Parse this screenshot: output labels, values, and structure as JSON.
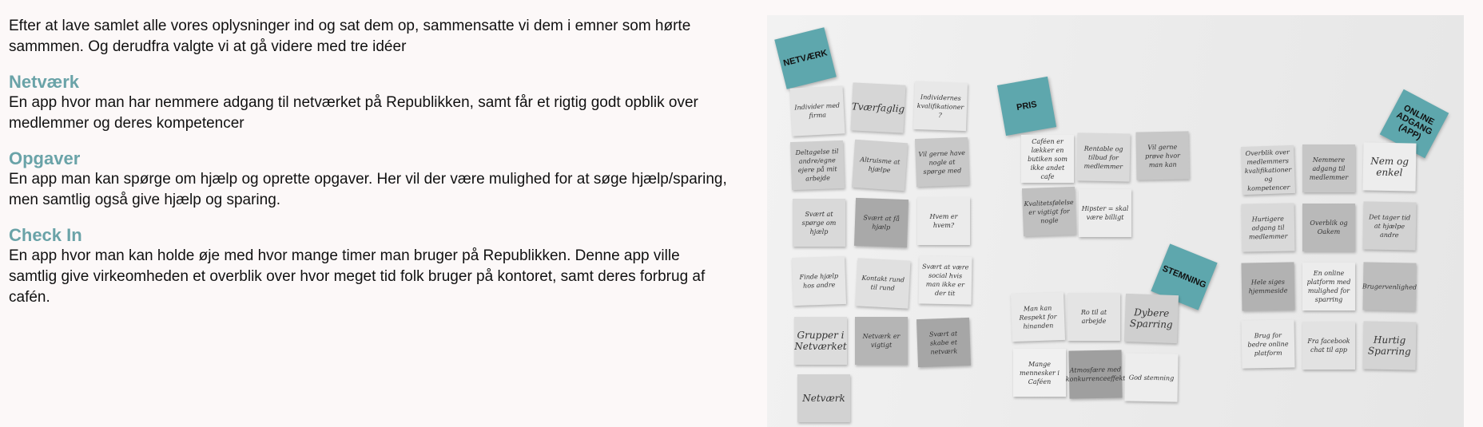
{
  "intro": "Efter at lave samlet alle vores oplysninger ind og sat dem op, sammensatte vi dem i emner som hørte sammmen. Og derudfra valgte vi at gå videre med tre idéer",
  "sections": [
    {
      "heading": "Netværk",
      "body": "En app hvor man har nemmere adgang til netværket på Republikken, samt får et rigtig godt opblik over medlemmer og deres kompetencer"
    },
    {
      "heading": "Opgaver",
      "body": "En app man kan spørge om hjælp og oprette opgaver. Her vil der være mulighed for at søge hjælp/sparing, men samtlig også give hjælp og sparing."
    },
    {
      "heading": "Check In",
      "body": "En app hvor man kan holde øje med hvor mange timer man bruger på Republikken. Denne app ville samtlig give virkeomheden et overblik over hvor meget tid folk bruger på kontoret, samt deres forbrug af cafén."
    }
  ],
  "photo": {
    "accent": "#5ea7ad",
    "tags": [
      "NETVÆRK",
      "PRIS",
      "STEMNING",
      "ONLINE ADGANG (APP)"
    ],
    "notes": [
      {
        "text": "Individer med firma",
        "shade": "#e4e4e4"
      },
      {
        "text": "Tværfaglig",
        "shade": "#d6d6d6"
      },
      {
        "text": "Individernes kvalifikationer ?",
        "shade": "#e8e8e8"
      },
      {
        "text": "Deltagelse til andre/egne ejere på mit arbejde",
        "shade": "#cfcfcf"
      },
      {
        "text": "Altruisme at hjælpe",
        "shade": "#d0d0d0"
      },
      {
        "text": "Vil gerne have nogle at spørge med",
        "shade": "#c8c8c8"
      },
      {
        "text": "Svært at spørge om hjælp",
        "shade": "#d9d9d9"
      },
      {
        "text": "Svært at få hjælp",
        "shade": "#a9a9a9"
      },
      {
        "text": "Hvem er hvem?",
        "shade": "#ebebeb"
      },
      {
        "text": "Finde hjælp hos andre",
        "shade": "#e6e6e6"
      },
      {
        "text": "Kontakt rund til rund",
        "shade": "#e0e0e0"
      },
      {
        "text": "Svært at være social hvis man ikke er der tit",
        "shade": "#ececec"
      },
      {
        "text": "Grupper i Netværket",
        "shade": "#dcdcdc"
      },
      {
        "text": "Netværk er vigtigt",
        "shade": "#b5b5b5"
      },
      {
        "text": "Svært at skabe et netværk",
        "shade": "#a6a6a6"
      },
      {
        "text": "Netværk",
        "shade": "#d2d2d2"
      },
      {
        "text": "Caféen er lækker en butiken som ikke andet cafe",
        "shade": "#eeeeee"
      },
      {
        "text": "Rentable og tilbud for medlemmer",
        "shade": "#dadada"
      },
      {
        "text": "Vil gerne prøve hvor man kan",
        "shade": "#c7c7c7"
      },
      {
        "text": "Kvalitetsfølelse er vigtigt for nogle",
        "shade": "#c0c0c0"
      },
      {
        "text": "Hipster = skal være billigt",
        "shade": "#ececec"
      },
      {
        "text": "Man kan Respekt for hinanden",
        "shade": "#e9e9e9"
      },
      {
        "text": "Ro til at arbejde",
        "shade": "#e4e4e4"
      },
      {
        "text": "Dybere Sparring",
        "shade": "#cfcfcf"
      },
      {
        "text": "Mange mennesker i Caféen",
        "shade": "#f0f0f0"
      },
      {
        "text": "Atmosfære med konkurrenceeffekt",
        "shade": "#9f9f9f"
      },
      {
        "text": "God stemning",
        "shade": "#ededed"
      },
      {
        "text": "Overblik over medlemmers kvalifikationer og kompetencer",
        "shade": "#d8d8d8"
      },
      {
        "text": "Nemmere adgang til medlemmer",
        "shade": "#c6c6c6"
      },
      {
        "text": "Nem og enkel",
        "shade": "#ededed"
      },
      {
        "text": "Hurtigere adgang til medlemmer",
        "shade": "#d9d9d9"
      },
      {
        "text": "Overblik og Oakem",
        "shade": "#b9b9b9"
      },
      {
        "text": "Det tager tid at hjælpe andre",
        "shade": "#d2d2d2"
      },
      {
        "text": "Hele siges hjemmeside",
        "shade": "#b2b2b2"
      },
      {
        "text": "En online platform med mulighed for sparring",
        "shade": "#ececec"
      },
      {
        "text": "Brugervenlighed",
        "shade": "#bdbdbd"
      },
      {
        "text": "Brug for bedre online platform",
        "shade": "#e9e9e9"
      },
      {
        "text": "Fra facebook chat til app",
        "shade": "#e2e2e2"
      },
      {
        "text": "Hurtig Sparring",
        "shade": "#d4d4d4"
      }
    ]
  }
}
